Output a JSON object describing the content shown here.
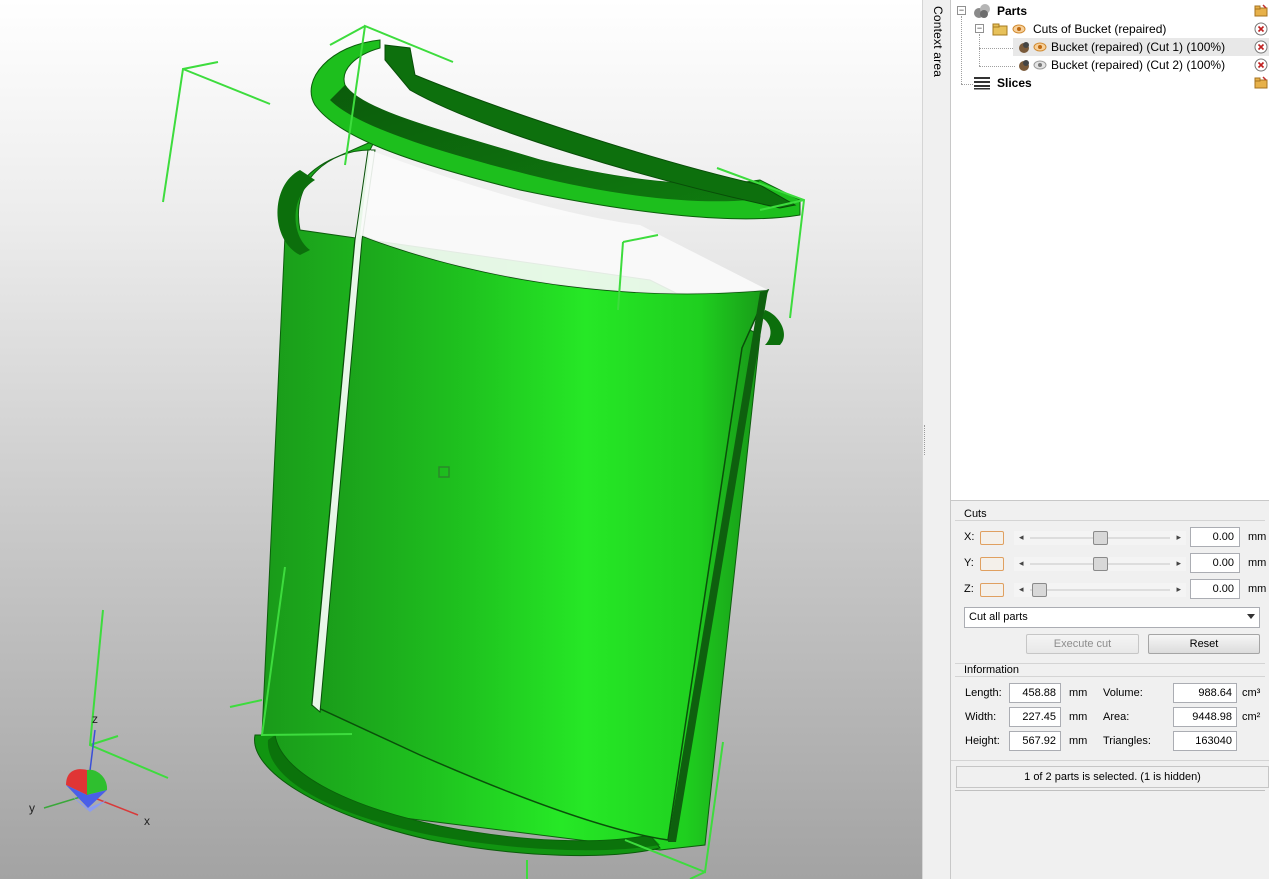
{
  "context_area": {
    "label": "Context area"
  },
  "tree": {
    "items": [
      {
        "label": "Parts",
        "bold": true
      },
      {
        "label": "Cuts of Bucket (repaired)"
      },
      {
        "label": "Bucket (repaired) (Cut 1) (100%)",
        "selected": true
      },
      {
        "label": "Bucket (repaired) (Cut 2) (100%)"
      },
      {
        "label": "Slices",
        "bold": true
      }
    ]
  },
  "cuts": {
    "title": "Cuts",
    "axes": [
      {
        "label": "X:",
        "value": "0.00",
        "unit": "mm",
        "slider_fraction": 0.5
      },
      {
        "label": "Y:",
        "value": "0.00",
        "unit": "mm",
        "slider_fraction": 0.5
      },
      {
        "label": "Z:",
        "value": "0.00",
        "unit": "mm",
        "slider_fraction": 0.0
      }
    ],
    "mode_select": "Cut all parts",
    "execute_label": "Execute cut",
    "reset_label": "Reset"
  },
  "information": {
    "title": "Information",
    "length": {
      "label": "Length:",
      "value": "458.88",
      "unit": "mm"
    },
    "width": {
      "label": "Width:",
      "value": "227.45",
      "unit": "mm"
    },
    "height": {
      "label": "Height:",
      "value": "567.92",
      "unit": "mm"
    },
    "volume": {
      "label": "Volume:",
      "value": "988.64",
      "unit": "cm³"
    },
    "area": {
      "label": "Area:",
      "value": "9448.98",
      "unit": "cm²"
    },
    "triangles": {
      "label": "Triangles:",
      "value": "163040"
    }
  },
  "status": "1 of 2 parts is selected. (1 is hidden)",
  "axis_labels": {
    "x": "x",
    "y": "y",
    "z": "z"
  },
  "colors": {
    "model_green": "#1fd11f",
    "bbox_green": "#33dd33",
    "swatch_border": "#e0a060"
  }
}
